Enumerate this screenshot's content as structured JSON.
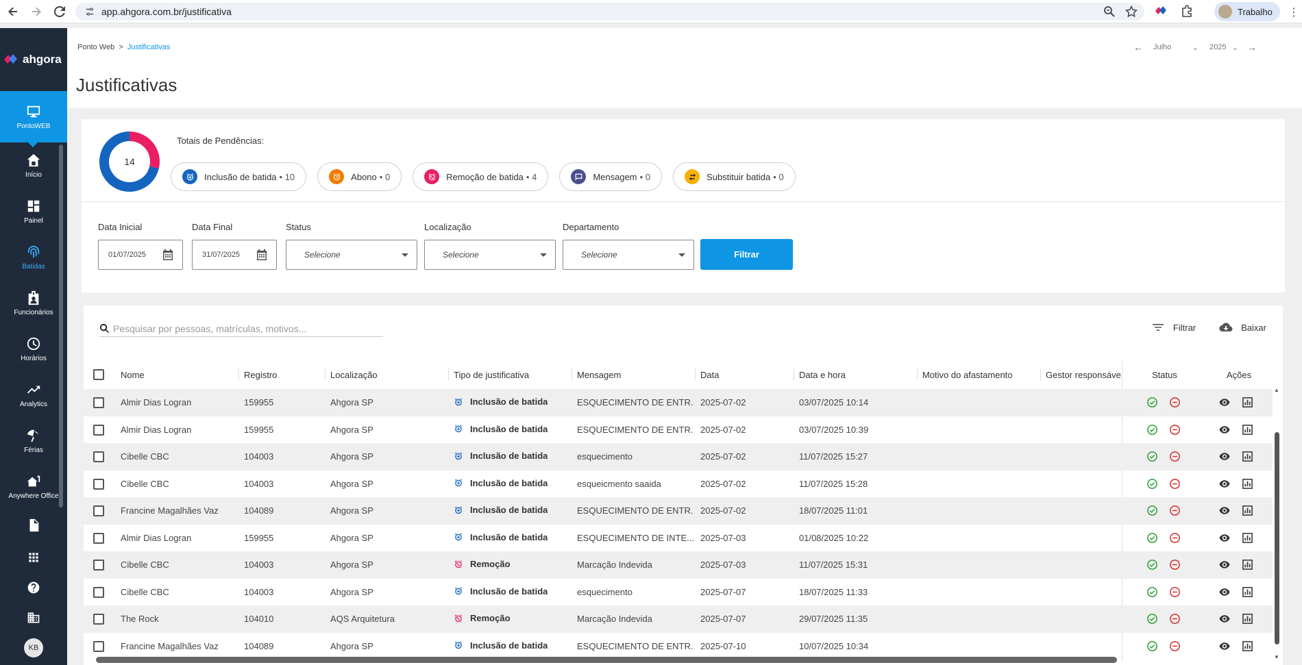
{
  "browser": {
    "url": "app.ahgora.com.br/justificativa",
    "profile": "Trabalho"
  },
  "sidebar": {
    "brand": "ahgora",
    "items": [
      {
        "label": "PontoWEB",
        "icon": "monitor-icon"
      },
      {
        "label": "Início",
        "icon": "home-icon"
      },
      {
        "label": "Painel",
        "icon": "dashboard-icon"
      },
      {
        "label": "Batidas",
        "icon": "fingerprint-icon"
      },
      {
        "label": "Funcionários",
        "icon": "badge-icon"
      },
      {
        "label": "Horários",
        "icon": "clock-icon"
      },
      {
        "label": "Analytics",
        "icon": "trending-icon"
      },
      {
        "label": "Férias",
        "icon": "beach-icon"
      },
      {
        "label": "Anywhere Office",
        "icon": "house-work-icon"
      }
    ],
    "user_initials": "KB"
  },
  "header": {
    "breadcrumb_root": "Ponto Web",
    "breadcrumb_sep": ">",
    "breadcrumb_current": "Justificativas",
    "title": "Justificativas",
    "month": "Julho",
    "year": "2025"
  },
  "summary": {
    "total": "14",
    "totals_label": "Totais de Pendências:",
    "pills": [
      {
        "label": "Inclusão de batida",
        "count": "10",
        "color": "#1565c0"
      },
      {
        "label": "Abono",
        "count": "0",
        "color": "#f57c00"
      },
      {
        "label": "Remoção de batida",
        "count": "4",
        "color": "#e91e63"
      },
      {
        "label": "Mensagem",
        "count": "0",
        "color": "#4a4f8f"
      },
      {
        "label": "Substituir batida",
        "count": "0",
        "color": "#f9b000"
      }
    ],
    "donut": {
      "inclusao_fraction": 0.714,
      "remocao_fraction": 0.286
    }
  },
  "filters": {
    "data_inicial_label": "Data Inicial",
    "data_inicial": "01/07/2025",
    "data_final_label": "Data Final",
    "data_final": "31/07/2025",
    "status_label": "Status",
    "localizacao_label": "Localização",
    "departamento_label": "Departamento",
    "select_placeholder": "Selecione",
    "filter_button": "Filtrar"
  },
  "table": {
    "search_placeholder": "Pesquisar por pessoas, matrículas, motivos...",
    "filter_action": "Filtrar",
    "download_action": "Baixar",
    "columns": [
      "Nome",
      "Registro",
      "Localização",
      "Tipo de justificativa",
      "Mensagem",
      "Data",
      "Data e hora",
      "Motivo do afastamento",
      "Gestor responsáve",
      "Status",
      "Ações"
    ],
    "rows": [
      {
        "nome": "Almir Dias Logran",
        "registro": "159955",
        "loc": "Ahgora SP",
        "tipo": "Inclusão de batida",
        "kind": "inc",
        "msg": "ESQUECIMENTO DE ENTR...",
        "data": "2025-07-02",
        "datahora": "03/07/2025 10:14"
      },
      {
        "nome": "Almir Dias Logran",
        "registro": "159955",
        "loc": "Ahgora SP",
        "tipo": "Inclusão de batida",
        "kind": "inc",
        "msg": "ESQUECIMENTO DE ENTR...",
        "data": "2025-07-02",
        "datahora": "03/07/2025 10:39"
      },
      {
        "nome": "Cibelle CBC",
        "registro": "104003",
        "loc": "Ahgora SP",
        "tipo": "Inclusão de batida",
        "kind": "inc",
        "msg": "esquecimento",
        "data": "2025-07-02",
        "datahora": "11/07/2025 15:27"
      },
      {
        "nome": "Cibelle CBC",
        "registro": "104003",
        "loc": "Ahgora SP",
        "tipo": "Inclusão de batida",
        "kind": "inc",
        "msg": "esqueicmento saaida",
        "data": "2025-07-02",
        "datahora": "11/07/2025 15:28"
      },
      {
        "nome": "Francine Magalhães Vaz",
        "registro": "104089",
        "loc": "Ahgora SP",
        "tipo": "Inclusão de batida",
        "kind": "inc",
        "msg": "ESQUECIMENTO DE ENTR...",
        "data": "2025-07-02",
        "datahora": "18/07/2025 11:01"
      },
      {
        "nome": "Almir Dias Logran",
        "registro": "159955",
        "loc": "Ahgora SP",
        "tipo": "Inclusão de batida",
        "kind": "inc",
        "msg": "ESQUECIMENTO DE INTE...",
        "data": "2025-07-03",
        "datahora": "01/08/2025 10:22"
      },
      {
        "nome": "Cibelle CBC",
        "registro": "104003",
        "loc": "Ahgora SP",
        "tipo": "Remoção",
        "kind": "rem",
        "msg": "Marcação Indevida",
        "data": "2025-07-03",
        "datahora": "11/07/2025 15:31"
      },
      {
        "nome": "Cibelle CBC",
        "registro": "104003",
        "loc": "Ahgora SP",
        "tipo": "Inclusão de batida",
        "kind": "inc",
        "msg": "esquecimento",
        "data": "2025-07-07",
        "datahora": "18/07/2025 11:33"
      },
      {
        "nome": "The Rock",
        "registro": "104010",
        "loc": "AQS Arquitetura",
        "tipo": "Remoção",
        "kind": "rem",
        "msg": "Marcação Indevida",
        "data": "2025-07-07",
        "datahora": "29/07/2025 11:35"
      },
      {
        "nome": "Francine Magalhães Vaz",
        "registro": "104089",
        "loc": "Ahgora SP",
        "tipo": "Inclusão de batida",
        "kind": "inc",
        "msg": "ESQUECIMENTO DE ENTR...",
        "data": "2025-07-10",
        "datahora": "10/07/2025 10:34"
      }
    ]
  }
}
